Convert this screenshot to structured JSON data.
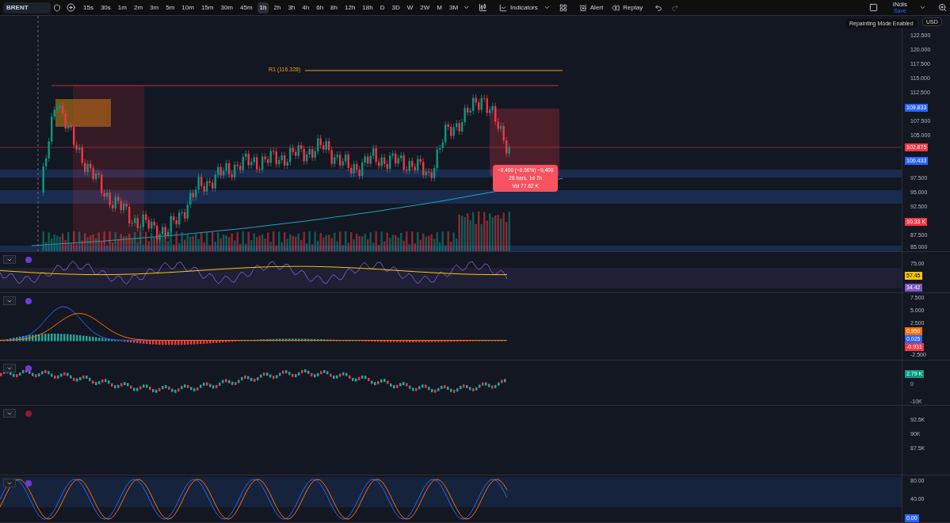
{
  "toolbar": {
    "symbol": "BRENT",
    "intervals": [
      {
        "label": "15s",
        "selected": false
      },
      {
        "label": "30s",
        "selected": false
      },
      {
        "label": "1m",
        "selected": false
      },
      {
        "label": "2m",
        "selected": false
      },
      {
        "label": "3m",
        "selected": false
      },
      {
        "label": "5m",
        "selected": false
      },
      {
        "label": "10m",
        "selected": false
      },
      {
        "label": "15m",
        "selected": false
      },
      {
        "label": "30m",
        "selected": false
      },
      {
        "label": "45m",
        "selected": false
      },
      {
        "label": "1h",
        "selected": true
      },
      {
        "label": "2h",
        "selected": false
      },
      {
        "label": "3h",
        "selected": false
      },
      {
        "label": "4h",
        "selected": false
      },
      {
        "label": "6h",
        "selected": false
      },
      {
        "label": "8h",
        "selected": false
      },
      {
        "label": "12h",
        "selected": false
      },
      {
        "label": "18h",
        "selected": false
      },
      {
        "label": "D",
        "selected": false
      },
      {
        "label": "3D",
        "selected": false
      },
      {
        "label": "W",
        "selected": false
      },
      {
        "label": "2W",
        "selected": false
      },
      {
        "label": "M",
        "selected": false
      },
      {
        "label": "3M",
        "selected": false
      }
    ],
    "indicators": "Indicators",
    "alert": "Alert",
    "replay": "Replay",
    "layout_name": "INdis",
    "save": "Save"
  },
  "currency": "USD",
  "notice": "Repainting Mode Enabled",
  "panes": [
    {
      "kind": "price",
      "ticks": [
        "122.500",
        "120.000",
        "117.500",
        "115.000",
        "112.500",
        "107.500",
        "105.000",
        "97.500",
        "95.000",
        "92.500",
        "87.500",
        "85.000"
      ],
      "labels": [
        {
          "text": "109.833",
          "color": "#2962ff"
        },
        {
          "text": "102.875",
          "color": "#f23645"
        },
        {
          "text": "100.433",
          "color": "#2962ff"
        },
        {
          "text": "10.33 K",
          "color": "#f23645"
        }
      ],
      "level_label": "R1 (116.328)",
      "measure": [
        "−9.400 (−8.56%) −9,400",
        "28 bars, 1d 7h",
        "Vol 77.62 K"
      ]
    },
    {
      "kind": "rsi",
      "ticks": [
        "75.00"
      ],
      "labels": [
        {
          "text": "57.45",
          "color": "#f7c600"
        },
        {
          "text": "34.42",
          "color": "#7e57c2"
        }
      ]
    },
    {
      "kind": "macd",
      "ticks": [
        "7.500",
        "5.000",
        "2.500",
        "-2.500"
      ],
      "labels": [
        {
          "text": "0.956",
          "color": "#ff6d00"
        },
        {
          "text": "0.025",
          "color": "#2962ff"
        },
        {
          "text": "-0.931",
          "color": "#f23645"
        }
      ]
    },
    {
      "kind": "bars",
      "ticks": [
        "0",
        "-10K"
      ],
      "labels": [
        {
          "text": "2.79 K",
          "color": "#089981"
        }
      ]
    },
    {
      "kind": "empty",
      "ticks": [
        "92.5K",
        "90K",
        "87.5K"
      ]
    },
    {
      "kind": "stoch",
      "ticks": [
        "80.00",
        "40.00"
      ],
      "labels": [
        {
          "text": "0.00",
          "color": "#2962ff"
        }
      ]
    }
  ]
}
